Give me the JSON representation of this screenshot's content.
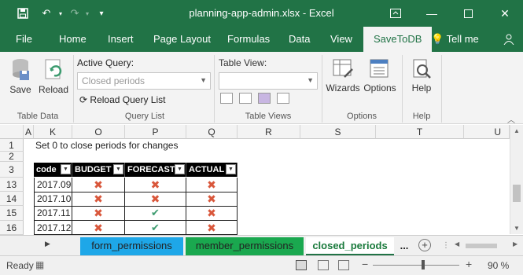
{
  "window": {
    "title": "planning-app-admin.xlsx  -  Excel"
  },
  "menu": {
    "items": [
      "File",
      "Home",
      "Insert",
      "Page Layout",
      "Formulas",
      "Data",
      "View",
      "SaveToDB"
    ],
    "tell_me": "Tell me"
  },
  "ribbon": {
    "save_label": "Save",
    "reload_label": "Reload",
    "active_query_label": "Active Query:",
    "active_query_value": "Closed periods",
    "reload_query_list": "Reload Query List",
    "table_view_label": "Table View:",
    "wizards_label": "Wizards",
    "options_label": "Options",
    "help_label": "Help",
    "groups": [
      "Table Data",
      "Query List",
      "Table Views",
      "Options",
      "Help"
    ]
  },
  "grid": {
    "columns": [
      "A",
      "K",
      "O",
      "P",
      "Q",
      "R",
      "S",
      "T",
      "U"
    ],
    "row_numbers": [
      "1",
      "2",
      "3",
      "13",
      "14",
      "15",
      "16"
    ],
    "note": "Set 0 to close periods for changes",
    "headers": [
      "code",
      "BUDGET",
      "FORECAST",
      "ACTUAL"
    ],
    "rows": [
      {
        "code": "2017.09",
        "budget": "✖",
        "forecast": "✖",
        "actual": "✖"
      },
      {
        "code": "2017.10",
        "budget": "✖",
        "forecast": "✖",
        "actual": "✖"
      },
      {
        "code": "2017.11",
        "budget": "✖",
        "forecast": "✔",
        "actual": "✖"
      },
      {
        "code": "2017.12",
        "budget": "✖",
        "forecast": "✔",
        "actual": "✖"
      }
    ]
  },
  "sheets": {
    "tabs": [
      "form_permissions",
      "member_permissions",
      "closed_periods"
    ],
    "more": "...",
    "colors": {
      "form_permissions": "#1ea7e8",
      "member_permissions": "#1aa84f"
    }
  },
  "status": {
    "ready": "Ready",
    "zoom": "90 %"
  }
}
